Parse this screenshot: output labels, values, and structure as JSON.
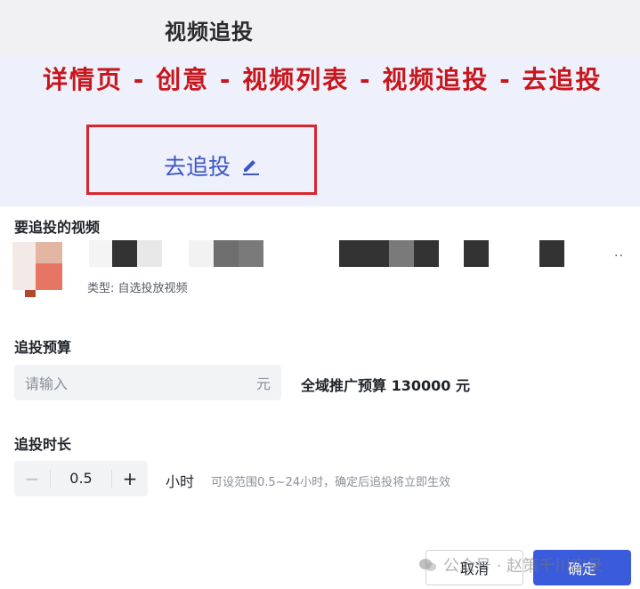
{
  "header": {
    "title": "视频追投"
  },
  "annotation": {
    "breadcrumb": "详情页 - 创意 - 视频列表 - 视频追投 - 去追投"
  },
  "entry": {
    "link_label": "去追投",
    "icon": "pencil-icon"
  },
  "video_section": {
    "label": "要追投的视频",
    "type_text": "类型: 自选投放视频",
    "more": "··"
  },
  "budget_section": {
    "label": "追投预算",
    "placeholder": "请输入",
    "unit": "元",
    "info": "全域推广预算 130000 元"
  },
  "duration_section": {
    "label": "追投时长",
    "value": "0.5",
    "minus": "−",
    "plus": "+",
    "unit": "小时",
    "hint": "可设范围0.5~24小时，确定后追投将立即生效"
  },
  "footer": {
    "cancel_label": "取消",
    "ok_label": "确定"
  },
  "watermark": {
    "text": "公众号 · 赵策千川实录"
  },
  "colors": {
    "accent": "#3a5bdb",
    "annotation_red": "#c8161d",
    "link_blue": "#3d56c8"
  }
}
